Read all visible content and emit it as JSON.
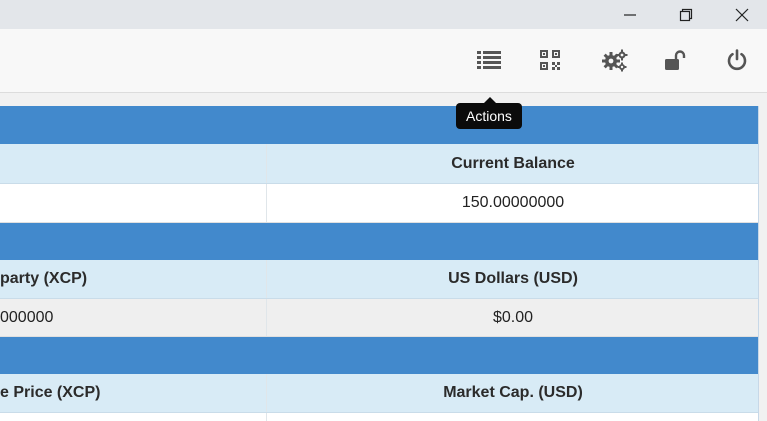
{
  "window": {
    "controls": [
      "minimize",
      "maximize",
      "close"
    ]
  },
  "toolbar": {
    "icons": [
      "list-icon",
      "qr-code-icon",
      "gears-icon",
      "unlock-icon",
      "power-icon"
    ],
    "tooltip": "Actions"
  },
  "tables": [
    {
      "left_header": "",
      "right_header": "Current Balance",
      "left_value": "",
      "right_value": "150.00000000"
    },
    {
      "left_header": "party (XCP)",
      "right_header": "US Dollars (USD)",
      "left_value": "000000",
      "right_value": "$0.00"
    },
    {
      "left_header": "e Price (XCP)",
      "right_header": "Market Cap. (USD)"
    }
  ],
  "colors": {
    "band": "#4289cc",
    "header": "#d8ebf6",
    "tooltip_bg": "#0b0b0b"
  }
}
